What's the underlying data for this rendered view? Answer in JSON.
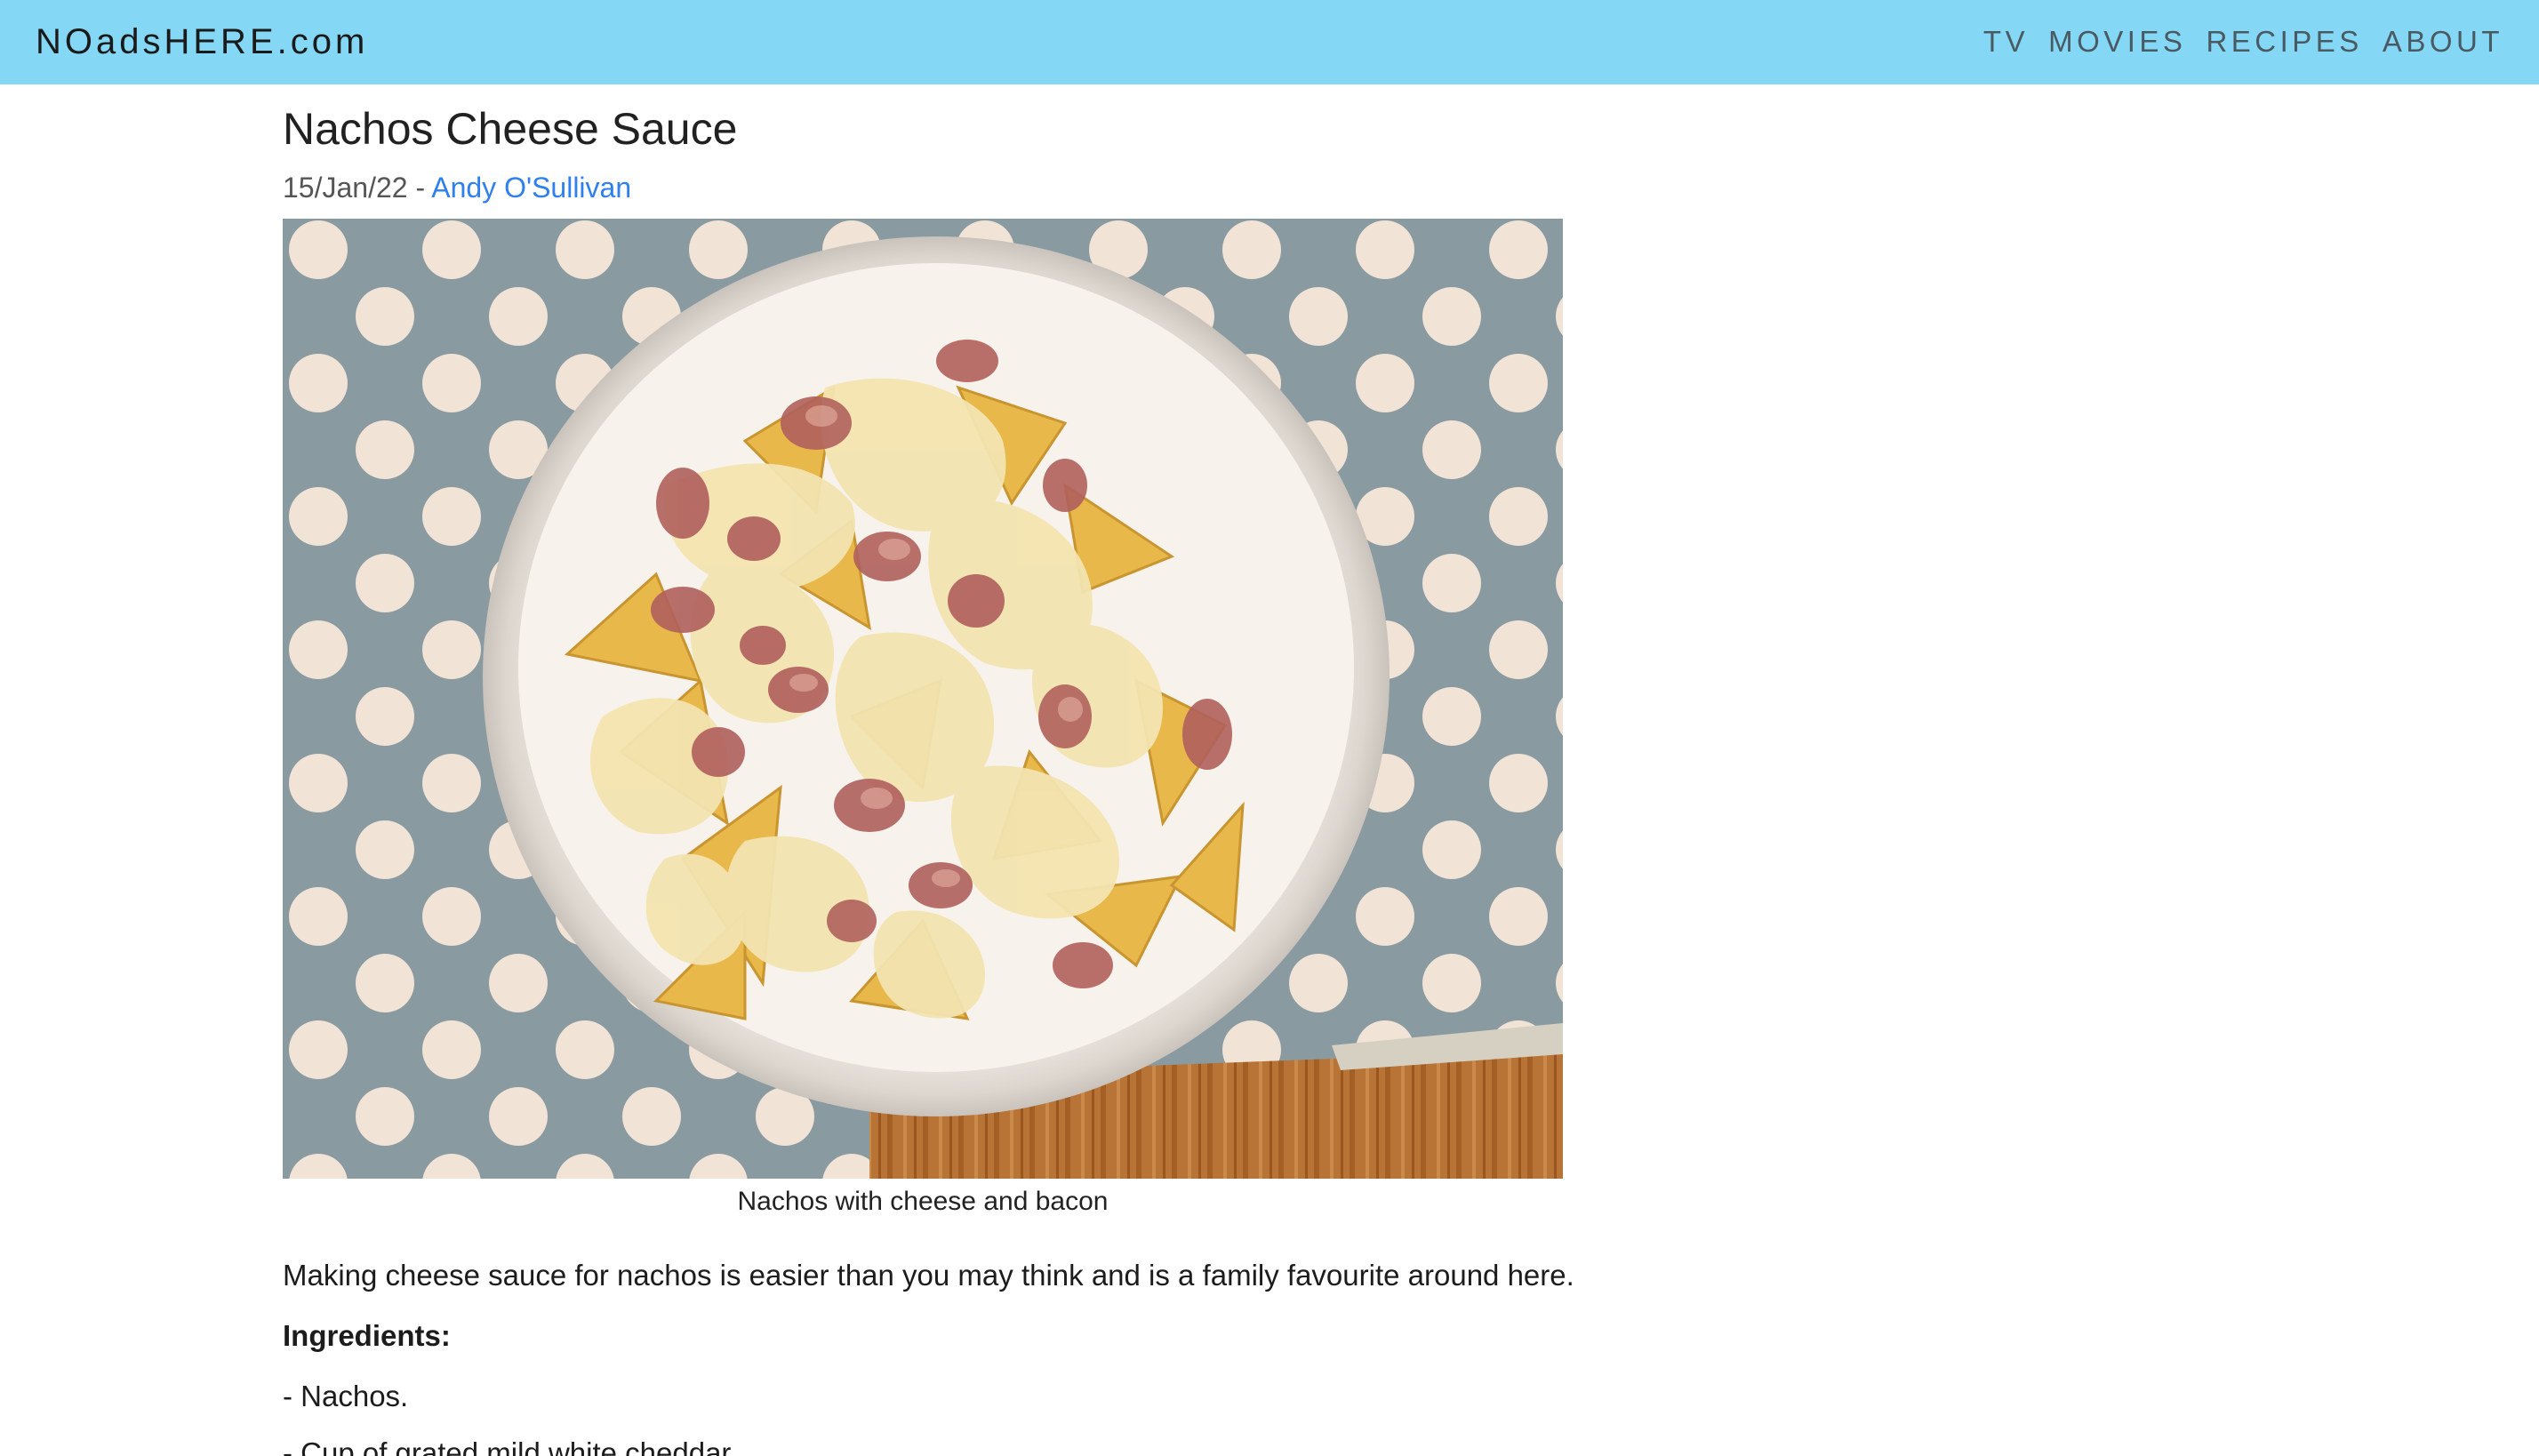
{
  "navbar": {
    "brand": "NOadsHERE.com",
    "links": [
      "TV",
      "MOVIES",
      "RECIPES",
      "ABOUT"
    ]
  },
  "article": {
    "title": "Nachos Cheese Sauce",
    "date": "15/Jan/22",
    "separator": " - ",
    "author": "Andy O'Sullivan",
    "image_caption": "Nachos with cheese and bacon",
    "intro": "Making cheese sauce for nachos is easier than you may think and is a family favourite around here.",
    "ingredients_heading": "Ingredients:",
    "ingredients": [
      "- Nachos.",
      "- Cup of grated mild white cheddar."
    ]
  },
  "colors": {
    "navbar_bg": "#84d8f6",
    "link": "#2f80ed"
  }
}
